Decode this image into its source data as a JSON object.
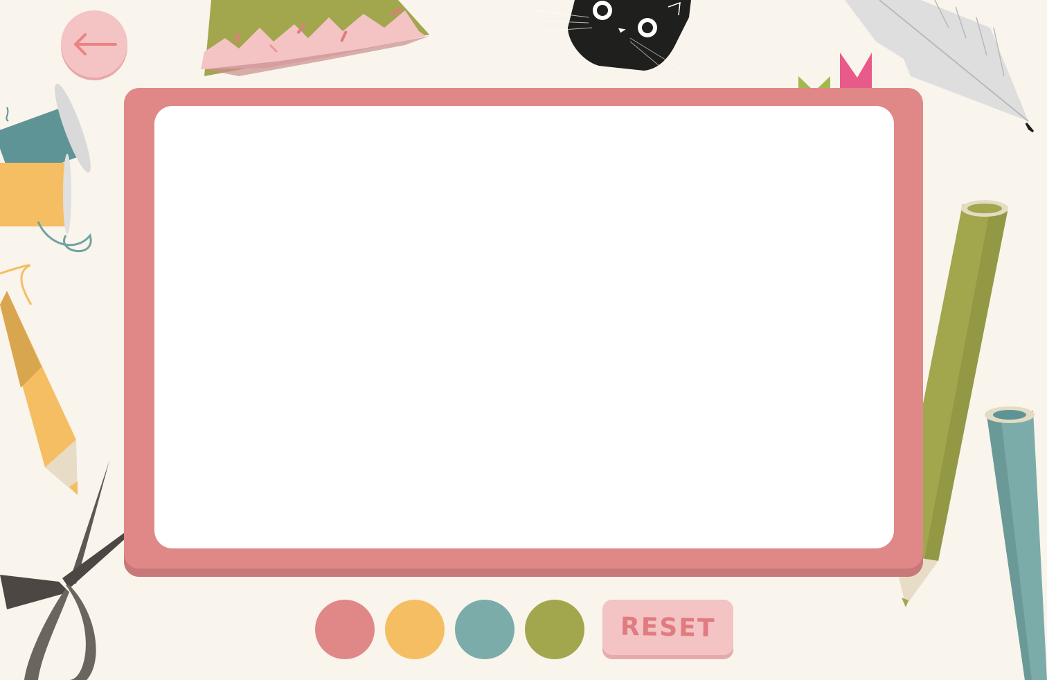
{
  "reset_label": "RESET",
  "colors": {
    "background": "#f9f4ec",
    "frame": "#e08888",
    "canvas": "#ffffff",
    "button": "#f4c3c3",
    "button_text": "#e07b80"
  },
  "palette": [
    {
      "name": "pink",
      "color": "#e08888"
    },
    {
      "name": "yellow",
      "color": "#f5be62"
    },
    {
      "name": "teal",
      "color": "#7bacaa"
    },
    {
      "name": "olive",
      "color": "#a2a64d"
    }
  ],
  "icons": {
    "back": "arrow-left-icon"
  },
  "decorations": [
    "party-hat",
    "black-cat",
    "feather-quill",
    "thread-spools",
    "yellow-pencil",
    "scissors",
    "green-pencil",
    "teal-pencil",
    "bookmark-tabs"
  ]
}
